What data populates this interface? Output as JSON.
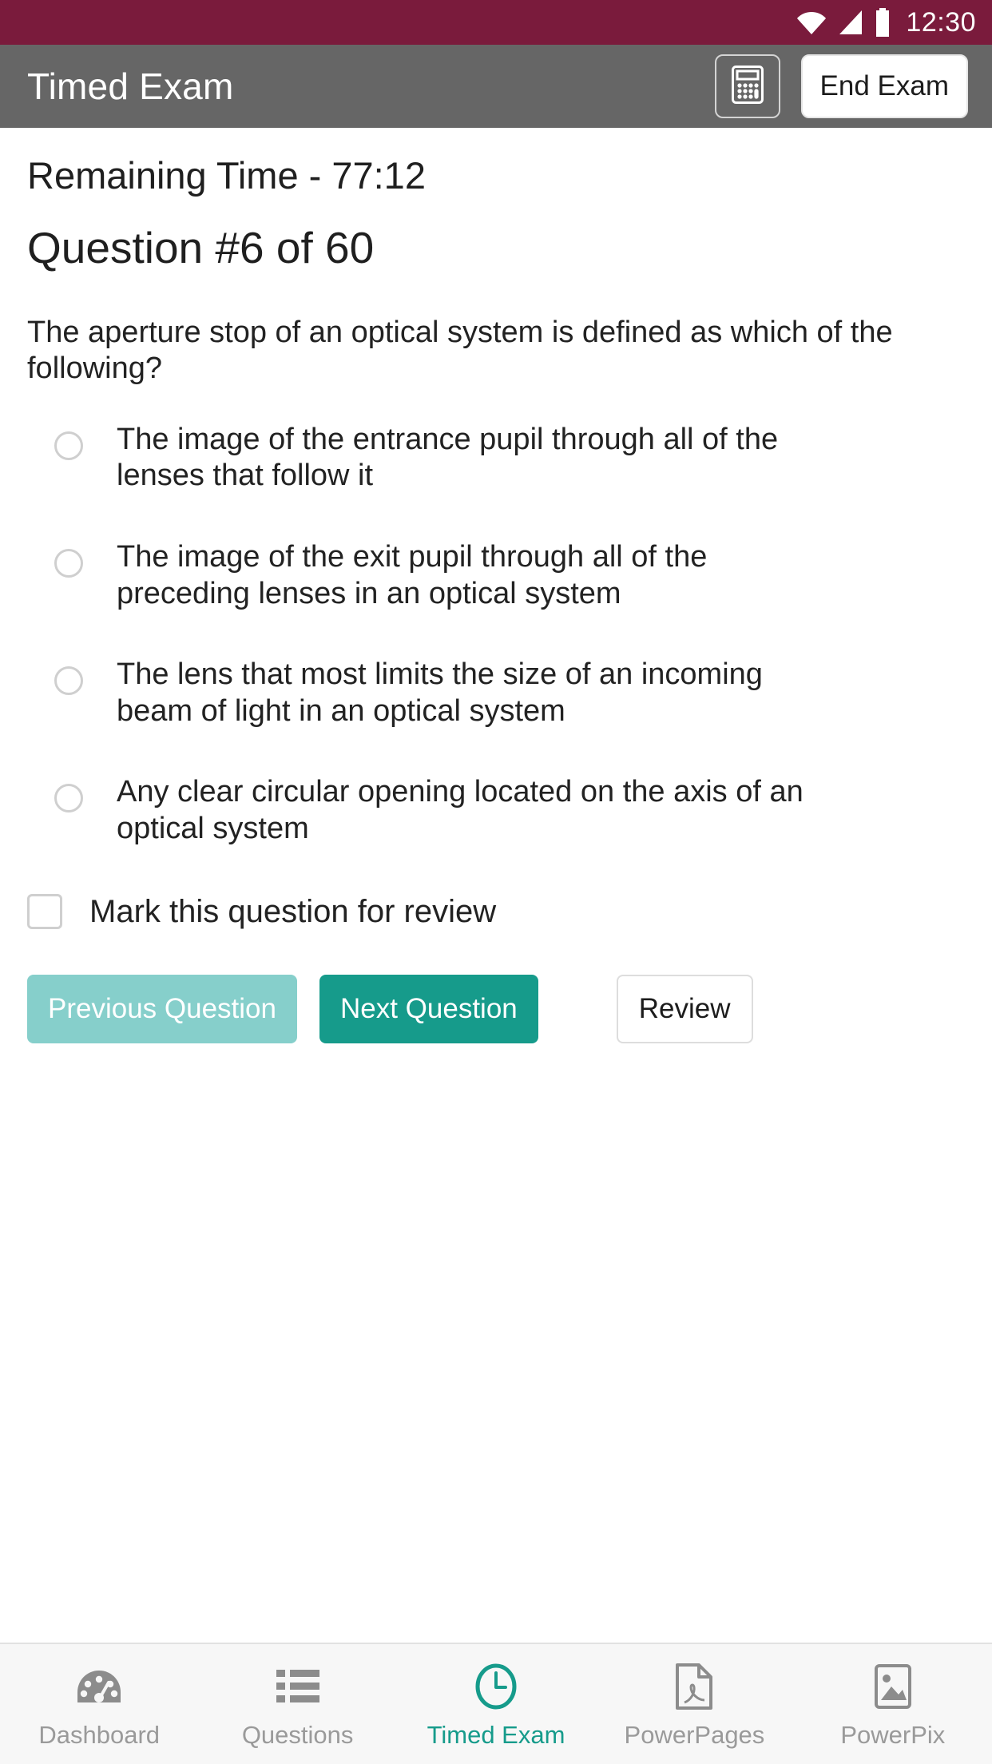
{
  "status_bar": {
    "time": "12:30",
    "background": "#7a1b3c",
    "icons": [
      "wifi-icon",
      "signal-icon",
      "battery-icon"
    ]
  },
  "app_bar": {
    "title": "Timed Exam",
    "background": "#666666",
    "calculator_icon": "calculator-icon",
    "end_exam_label": "End Exam"
  },
  "exam": {
    "remaining_time_label": "Remaining Time - 77:12",
    "question_counter": "Question #6 of 60",
    "question_text": "The aperture stop of an optical system is defined as which of the following?",
    "options": [
      {
        "label": "The image of the entrance pupil through all of the lenses that follow it",
        "selected": false
      },
      {
        "label": "The image of the exit pupil through all of the preceding lenses in an optical system",
        "selected": false
      },
      {
        "label": "The lens that most limits the size of an incoming beam of light in an optical system",
        "selected": false
      },
      {
        "label": "Any clear circular opening located on the axis of an optical system",
        "selected": false
      }
    ],
    "mark_for_review_label": "Mark this question for review",
    "mark_for_review_checked": false
  },
  "actions": {
    "previous_label": "Previous Question",
    "next_label": "Next Question",
    "review_label": "Review",
    "previous_color": "#86cfcb",
    "next_color": "#169b8b"
  },
  "bottom_nav": {
    "active_color": "#169b8b",
    "inactive_color": "#9a9a9a",
    "items": [
      {
        "label": "Dashboard",
        "icon": "gauge-icon",
        "active": false
      },
      {
        "label": "Questions",
        "icon": "list-icon",
        "active": false
      },
      {
        "label": "Timed Exam",
        "icon": "clock-icon",
        "active": true
      },
      {
        "label": "PowerPages",
        "icon": "pdf-file-icon",
        "active": false
      },
      {
        "label": "PowerPix",
        "icon": "image-icon",
        "active": false
      }
    ]
  }
}
